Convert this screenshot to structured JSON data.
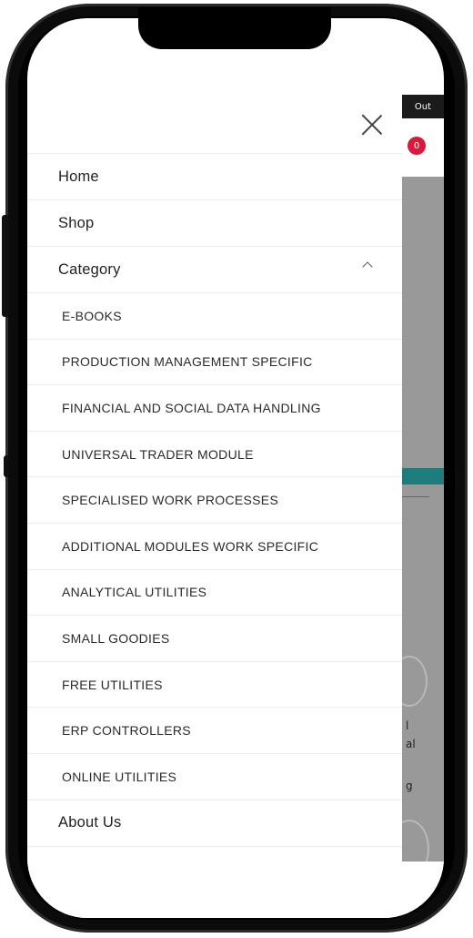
{
  "background_page": {
    "topbar_text": "Out",
    "cart_count": "0",
    "snippets": [
      "l",
      "al",
      "g"
    ]
  },
  "drawer": {
    "menu": {
      "home": "Home",
      "shop": "Shop",
      "category": "Category",
      "about": "About Us"
    },
    "categories": [
      "E-BOOKS",
      "PRODUCTION MANAGEMENT SPECIFIC",
      "FINANCIAL AND SOCIAL DATA HANDLING",
      "UNIVERSAL TRADER MODULE",
      "SPECIALISED WORK PROCESSES",
      "ADDITIONAL MODULES WORK SPECIFIC",
      "ANALYTICAL UTILITIES",
      "SMALL GOODIES",
      "FREE UTILITIES",
      "ERP CONTROLLERS",
      "ONLINE UTILITIES"
    ]
  }
}
